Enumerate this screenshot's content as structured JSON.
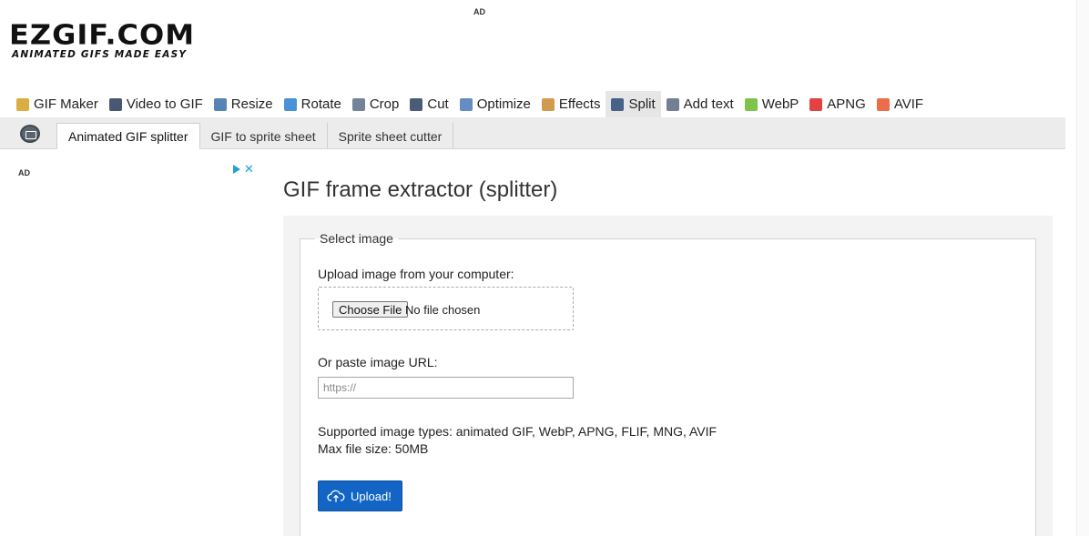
{
  "header": {
    "logo_main": "EZGIF.COM",
    "logo_tagline": "ANIMATED GIFS MADE EASY",
    "ad_label": "AD"
  },
  "mainnav": {
    "items": [
      {
        "label": "GIF Maker",
        "icon": "gif-maker-icon",
        "color": "#d4a020"
      },
      {
        "label": "Video to GIF",
        "icon": "film-icon",
        "color": "#2a3a5a"
      },
      {
        "label": "Resize",
        "icon": "resize-icon",
        "color": "#3a6ea8"
      },
      {
        "label": "Rotate",
        "icon": "rotate-icon",
        "color": "#2a7fd0"
      },
      {
        "label": "Crop",
        "icon": "crop-icon",
        "color": "#5a6e88"
      },
      {
        "label": "Cut",
        "icon": "cut-icon",
        "color": "#2a4060"
      },
      {
        "label": "Optimize",
        "icon": "optimize-icon",
        "color": "#4a78b8"
      },
      {
        "label": "Effects",
        "icon": "palette-icon",
        "color": "#c88a30"
      },
      {
        "label": "Split",
        "icon": "split-icon",
        "color": "#2a4a78"
      },
      {
        "label": "Add text",
        "icon": "add-text-icon",
        "color": "#5a6a80"
      },
      {
        "label": "WebP",
        "icon": "webp-icon",
        "color": "#6ab82a"
      },
      {
        "label": "APNG",
        "icon": "apng-icon",
        "color": "#e02020"
      },
      {
        "label": "AVIF",
        "icon": "avif-icon",
        "color": "#e8542a"
      }
    ],
    "active": "Split"
  },
  "subnav": {
    "tabs": [
      "Animated GIF splitter",
      "GIF to sprite sheet",
      "Sprite sheet cutter"
    ],
    "active": "Animated GIF splitter"
  },
  "sidebar": {
    "ad_label": "AD"
  },
  "main": {
    "title": "GIF frame extractor (splitter)",
    "legend": "Select image",
    "upload_label": "Upload image from your computer:",
    "choose_file": "Choose File",
    "no_file": "No file chosen",
    "url_label": "Or paste image URL:",
    "url_placeholder": "https://",
    "supported": "Supported image types: animated GIF, WebP, APNG, FLIF, MNG, AVIF",
    "max_size": "Max file size: 50MB",
    "upload_button": "Upload!"
  },
  "colors": {
    "upload_button": "#1265c4",
    "adchoices": "#1fa0d8"
  }
}
